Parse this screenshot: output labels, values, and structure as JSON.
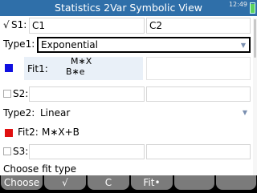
{
  "header": {
    "title": "Statistics 2Var Symbolic View",
    "time": "12:49"
  },
  "rows": {
    "s1": {
      "check_mark": "√",
      "label": "S1:",
      "col1": "C1",
      "col2": "C2"
    },
    "type1": {
      "label": "Type1:",
      "value": "Exponential"
    },
    "fit1": {
      "label": "Fit1:",
      "formula_base": "B∗e",
      "formula_exponent": "M∗X",
      "color": "#1010e0"
    },
    "s2": {
      "label": "S2:",
      "col1": "",
      "col2": ""
    },
    "type2": {
      "label": "Type2:",
      "value": "Linear"
    },
    "fit2": {
      "label": "Fit2:",
      "formula": "M∗X+B",
      "color": "#e01010"
    },
    "s3": {
      "label": "S3:",
      "col1": "",
      "col2": ""
    }
  },
  "status": "Choose fit type",
  "softkeys": [
    "Choose",
    "√",
    "C",
    "Fit•",
    "",
    ""
  ]
}
